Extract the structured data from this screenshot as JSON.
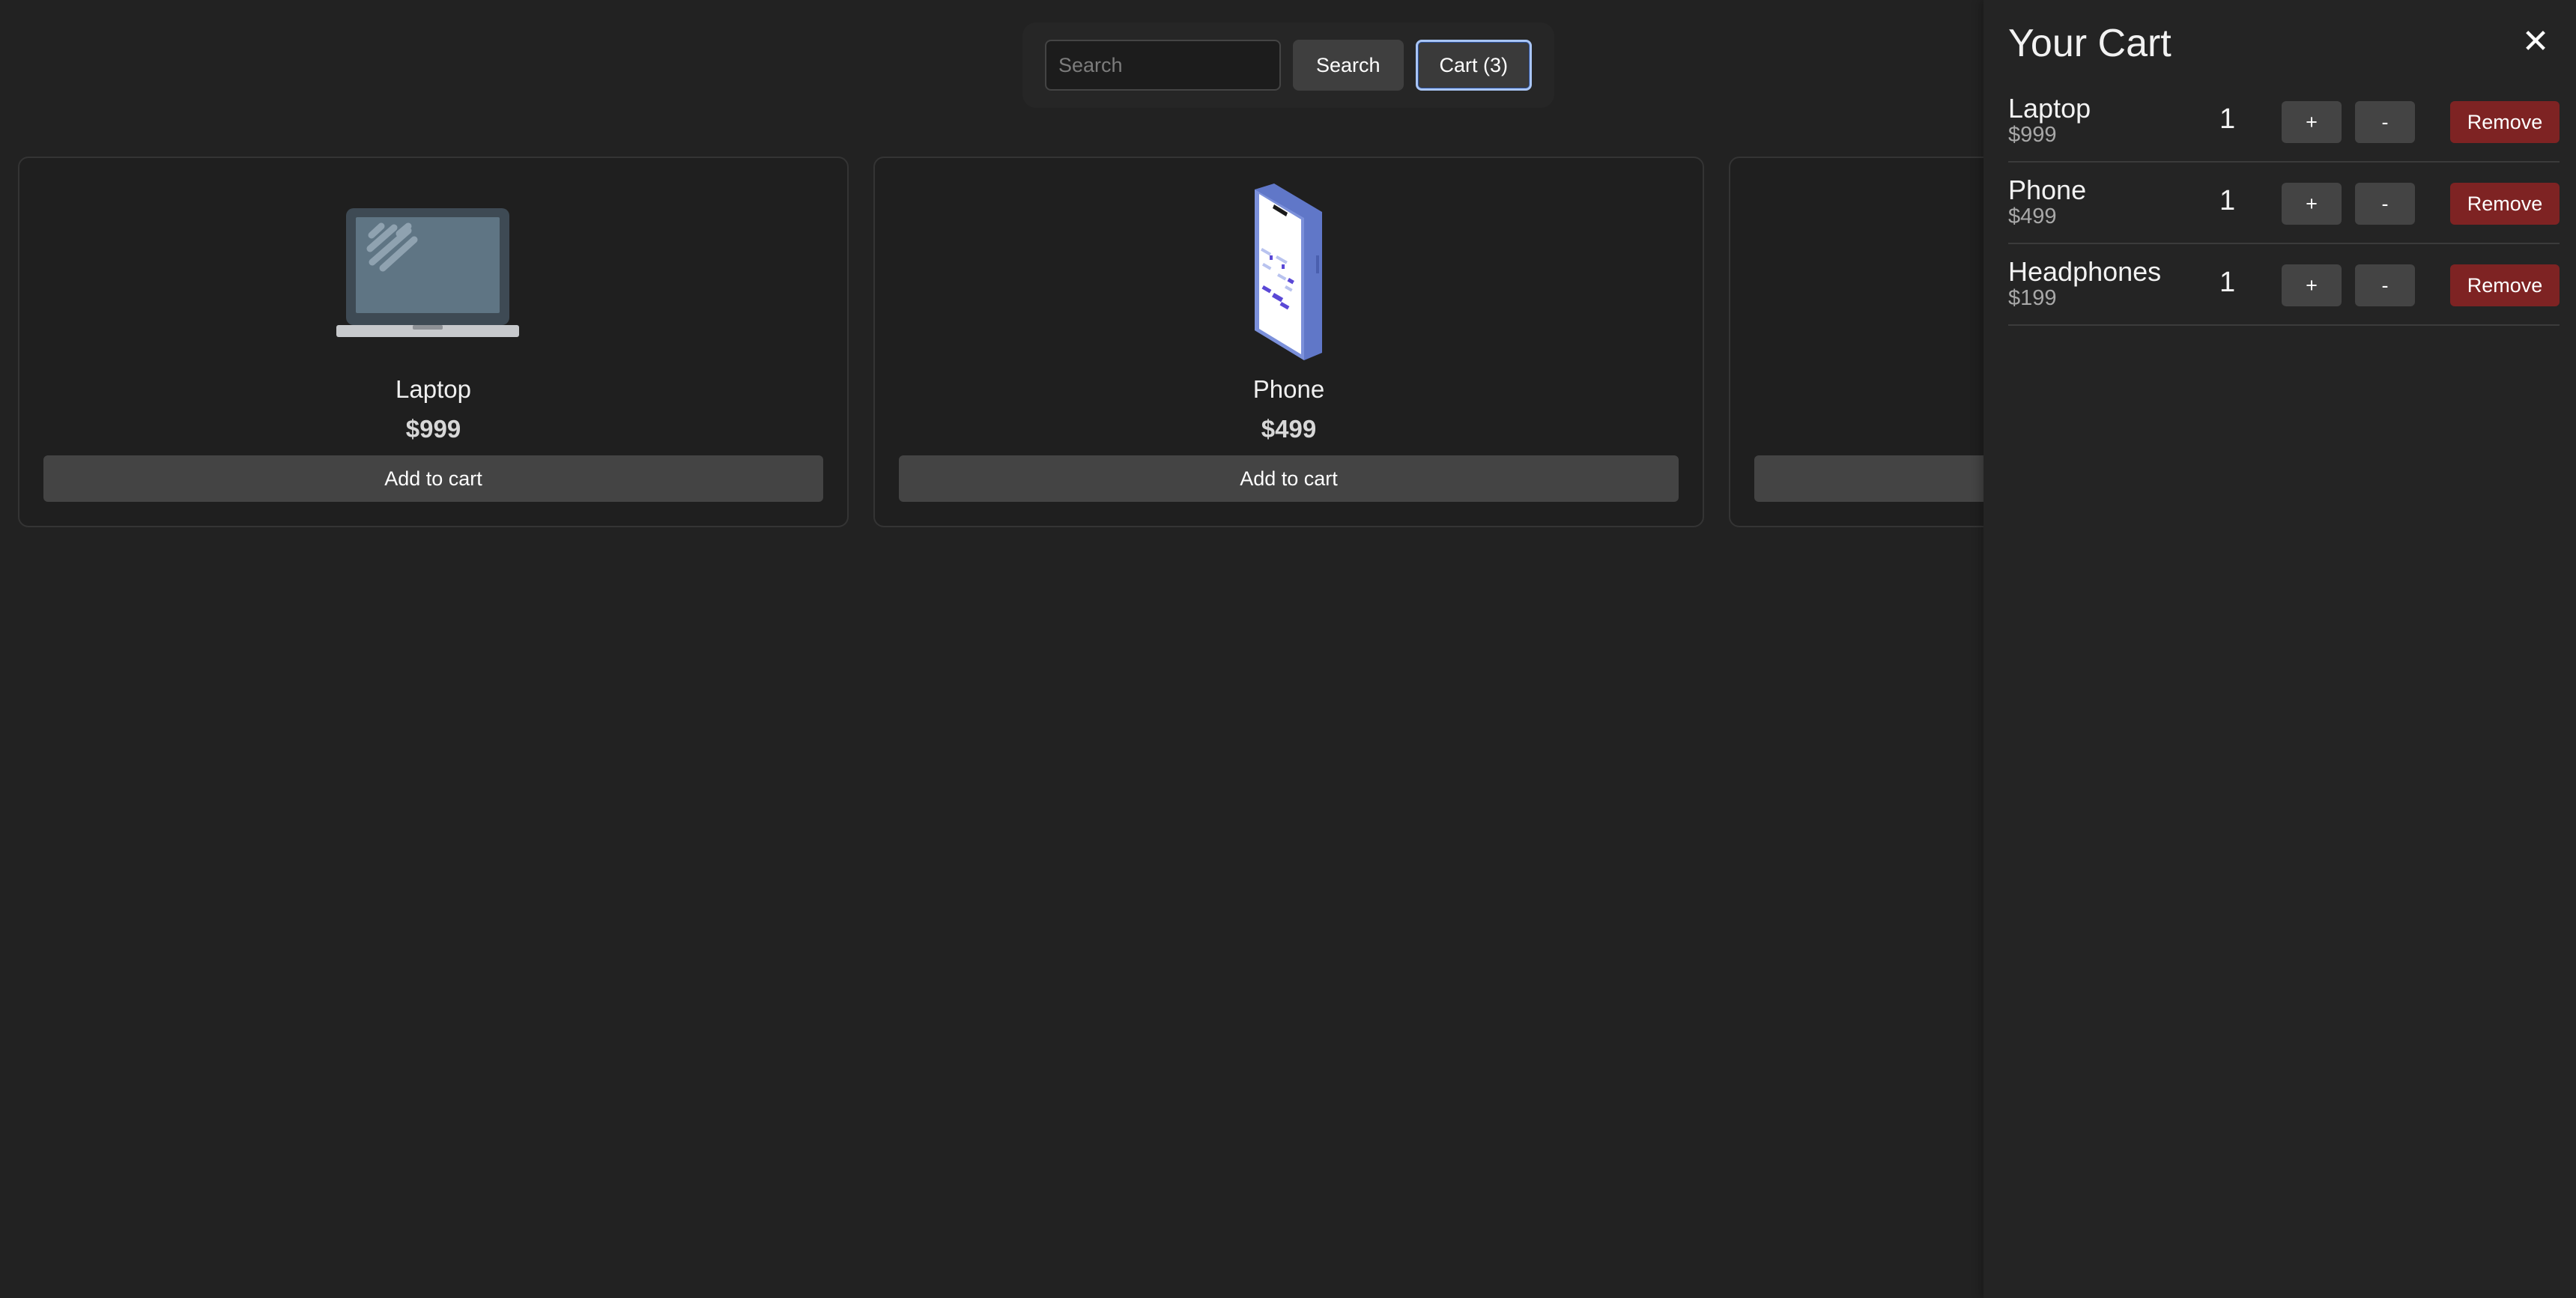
{
  "search": {
    "placeholder": "Search",
    "button_label": "Search",
    "cart_button_label": "Cart (3)"
  },
  "products": [
    {
      "name": "Laptop",
      "price": "$999",
      "button_label": "Add to cart",
      "icon": "laptop-icon"
    },
    {
      "name": "Phone",
      "price": "$499",
      "button_label": "Add to cart",
      "icon": "phone-icon"
    },
    {
      "name": "",
      "price": "",
      "button_label": "",
      "icon": ""
    }
  ],
  "cart": {
    "title": "Your Cart",
    "close_label": "✕",
    "items": [
      {
        "name": "Laptop",
        "price": "$999",
        "qty": "1",
        "plus_label": "+",
        "minus_label": "-",
        "remove_label": "Remove"
      },
      {
        "name": "Phone",
        "price": "$499",
        "qty": "1",
        "plus_label": "+",
        "minus_label": "-",
        "remove_label": "Remove"
      },
      {
        "name": "Headphones",
        "price": "$199",
        "qty": "1",
        "plus_label": "+",
        "minus_label": "-",
        "remove_label": "Remove"
      }
    ]
  },
  "colors": {
    "background": "#222222",
    "card": "#1f1f1f",
    "button": "#444444",
    "remove_button": "#7e2323",
    "focus_ring": "#a9c5f5"
  }
}
